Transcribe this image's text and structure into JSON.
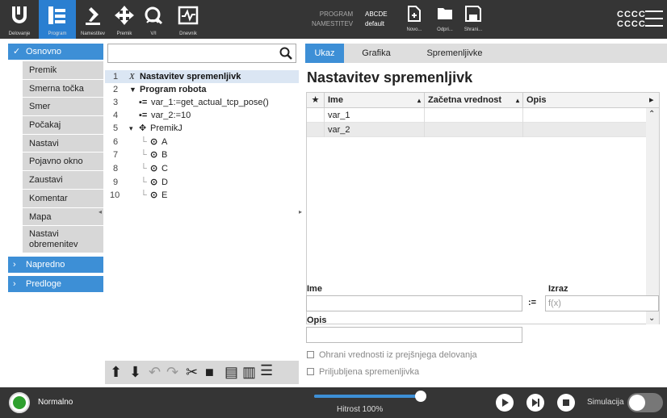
{
  "topbar": {
    "tabs": [
      {
        "label": "Delovanje",
        "icon": "ur-logo-icon"
      },
      {
        "label": "Program",
        "icon": "program-icon"
      },
      {
        "label": "Namestitev",
        "icon": "installation-icon"
      },
      {
        "label": "Premik",
        "icon": "move-icon"
      },
      {
        "label": "V/I",
        "icon": "io-icon"
      },
      {
        "label": "Dnevnik",
        "icon": "log-icon"
      }
    ],
    "program_label": "PROGRAM",
    "program_value": "ABCDE",
    "installation_label": "NAMESTITEV",
    "installation_value": "default",
    "file_buttons": [
      {
        "label": "Novo...",
        "icon": "new-file-icon"
      },
      {
        "label": "Odpri...",
        "icon": "folder-icon"
      },
      {
        "label": "Shrani...",
        "icon": "save-icon"
      }
    ],
    "right_line1": "CCCC",
    "right_line2": "CCCC",
    "accent": "#2a7fd1"
  },
  "leftnav": {
    "section_basic": "Osnovno",
    "items": [
      "Premik",
      "Smerna točka",
      "Smer",
      "Počakaj",
      "Nastavi",
      "Pojavno okno",
      "Zaustavi",
      "Komentar",
      "Mapa",
      "Nastavi obremenitev"
    ],
    "section_advanced": "Napredno",
    "section_templates": "Predloge"
  },
  "tree": {
    "search_placeholder": "",
    "lines": [
      {
        "num": "1",
        "prefix": "X",
        "text": "Nastavitev spremenljivk"
      },
      {
        "num": "2",
        "prefix": "▼",
        "text": "Program robota"
      },
      {
        "num": "3",
        "text": "var_1:=get_actual_tcp_pose()"
      },
      {
        "num": "4",
        "text": "var_2:=10"
      },
      {
        "num": "5",
        "text": "PremikJ"
      },
      {
        "num": "6",
        "text": "A"
      },
      {
        "num": "7",
        "text": "B"
      },
      {
        "num": "8",
        "text": "C"
      },
      {
        "num": "9",
        "text": "D"
      },
      {
        "num": "10",
        "text": "E"
      }
    ]
  },
  "right": {
    "tabs": [
      "Ukaz",
      "Grafika",
      "Spremenljivke"
    ],
    "title": "Nastavitev spremenljivk",
    "columns": [
      "★",
      "Ime",
      "Začetna vrednost",
      "Opis"
    ],
    "rows": [
      {
        "name": "var_1",
        "init": "",
        "desc": ""
      },
      {
        "name": "var_2",
        "init": "",
        "desc": ""
      }
    ],
    "name_label": "Ime",
    "expr_label": "Izraz",
    "assign_symbol": ":=",
    "expr_placeholder": "f(x)",
    "desc_label": "Opis",
    "check_keep": "Ohrani vrednosti iz prejšnjega delovanja",
    "check_fav": "Priljubljena spremenljivka"
  },
  "bottombar": {
    "status": "Normalno",
    "speed": "Hitrost 100%",
    "speed_fraction": 1.0,
    "sim_label": "Simulacija"
  }
}
